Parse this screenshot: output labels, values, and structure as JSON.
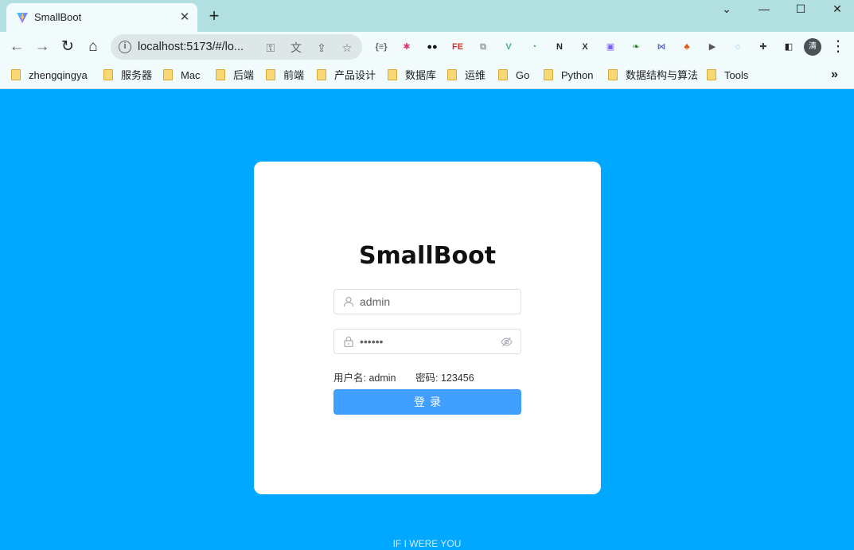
{
  "browser": {
    "tab_title": "SmallBoot",
    "close_glyph": "✕",
    "new_tab_glyph": "+",
    "url": "localhost:5173/#/lo...",
    "avatar_initial": "清",
    "window_controls": {
      "minimize": "—",
      "maximize": "☐",
      "close": "✕",
      "dropdown": "⌄"
    },
    "bookmarks": [
      "zhengqingya",
      "服务器",
      "Mac",
      "后端",
      "前端",
      "产品设计",
      "数据库",
      "运维",
      "Go",
      "Python",
      "数据结构与算法",
      "Tools"
    ],
    "more_glyph": "»",
    "extensions": [
      {
        "icon": "json-viewer-icon",
        "color": "#5f6368",
        "label": "{≡}"
      },
      {
        "icon": "pinwheel-icon",
        "color": "#e0397a",
        "label": "✱"
      },
      {
        "icon": "tampermonkey-icon",
        "color": "#111111",
        "label": "●●"
      },
      {
        "icon": "fe-helper-icon",
        "color": "#d32f2f",
        "label": "FE"
      },
      {
        "icon": "screenshot-icon",
        "color": "#9aa0a6",
        "label": "⧉"
      },
      {
        "icon": "vue-devtools-icon",
        "color": "#41b883",
        "label": "V"
      },
      {
        "icon": "octotree-icon",
        "color": "#4caf50",
        "label": "◔"
      },
      {
        "icon": "notion-icon",
        "color": "#222222",
        "label": "N"
      },
      {
        "icon": "x-extension-icon",
        "color": "#333333",
        "label": "X"
      },
      {
        "icon": "colorful-grid-icon",
        "color": "#7c5cf5",
        "label": "▣"
      },
      {
        "icon": "leaf-icon",
        "color": "#2e7d32",
        "label": "❧"
      },
      {
        "icon": "mini-bow-icon",
        "color": "#5c6bc0",
        "label": "⋈"
      },
      {
        "icon": "tree-icon",
        "color": "#e65100",
        "label": "♣"
      },
      {
        "icon": "play-icon",
        "color": "#555555",
        "label": "▶"
      },
      {
        "icon": "chat-bubble-icon",
        "color": "#2196f3",
        "label": "◌"
      },
      {
        "icon": "puzzle-icon",
        "color": "#3c4043",
        "label": "✚"
      },
      {
        "icon": "sidepanel-icon",
        "color": "#202124",
        "label": "◧"
      }
    ]
  },
  "login": {
    "title": "SmallBoot",
    "username_value": "admin",
    "password_value": "123456",
    "hint_username": "用户名: admin",
    "hint_password": "密码: 123456",
    "button_label": "登录"
  },
  "footer_text": "IF I WERE YOU",
  "colors": {
    "page_bg": "#00a8ff",
    "button": "#409eff",
    "card": "#ffffff"
  }
}
